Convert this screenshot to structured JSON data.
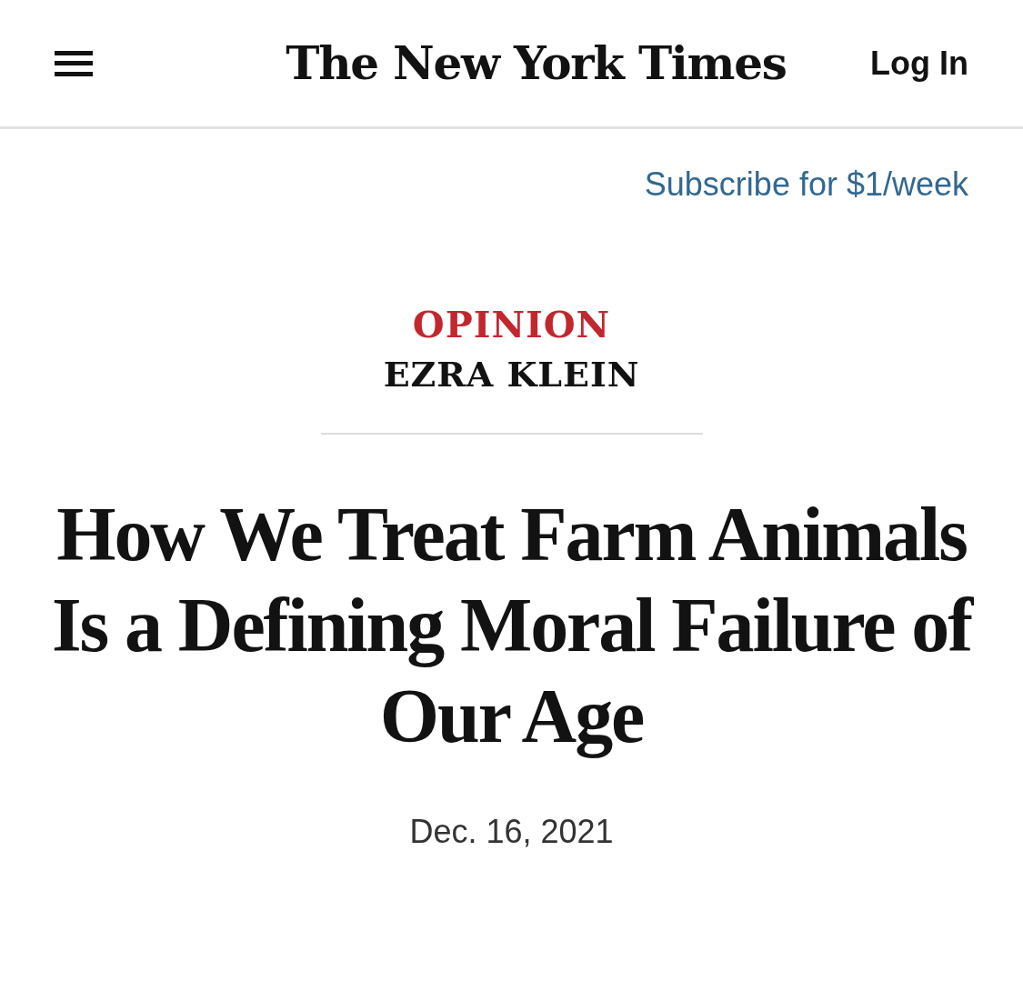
{
  "header": {
    "logo": "The New York Times",
    "login": "Log In"
  },
  "subscribe": "Subscribe for $1/week",
  "article": {
    "section": "OPINION",
    "author": "EZRA KLEIN",
    "headline": "How We Treat Farm Animals Is a Defining Moral Failure of Our Age",
    "date": "Dec. 16, 2021"
  }
}
